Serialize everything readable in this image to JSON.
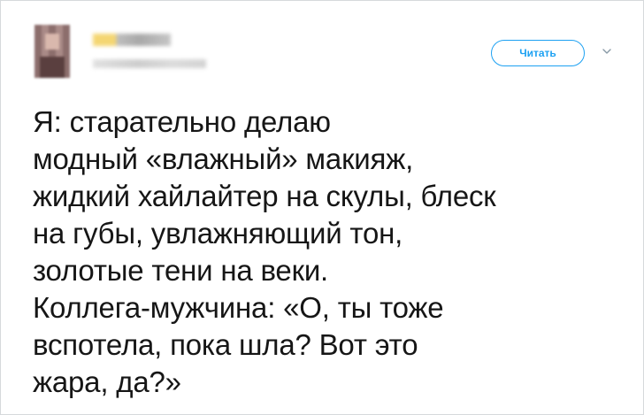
{
  "tweet": {
    "follow_label": "Читать",
    "text_lines": [
      "Я: старательно делаю",
      "модный «влажный» макияж,",
      "жидкий хайлайтер на скулы, блеск",
      "на губы, увлажняющий тон,",
      "золотые тени на веки.",
      "Коллега-мужчина: «О, ты тоже",
      "вспотела, пока шла? Вот это",
      "жара, да?»"
    ]
  },
  "icons": {
    "menu": "chevron-down-icon"
  },
  "colors": {
    "accent": "#1da1f2",
    "text": "#161616",
    "border": "#d6d9dc"
  }
}
